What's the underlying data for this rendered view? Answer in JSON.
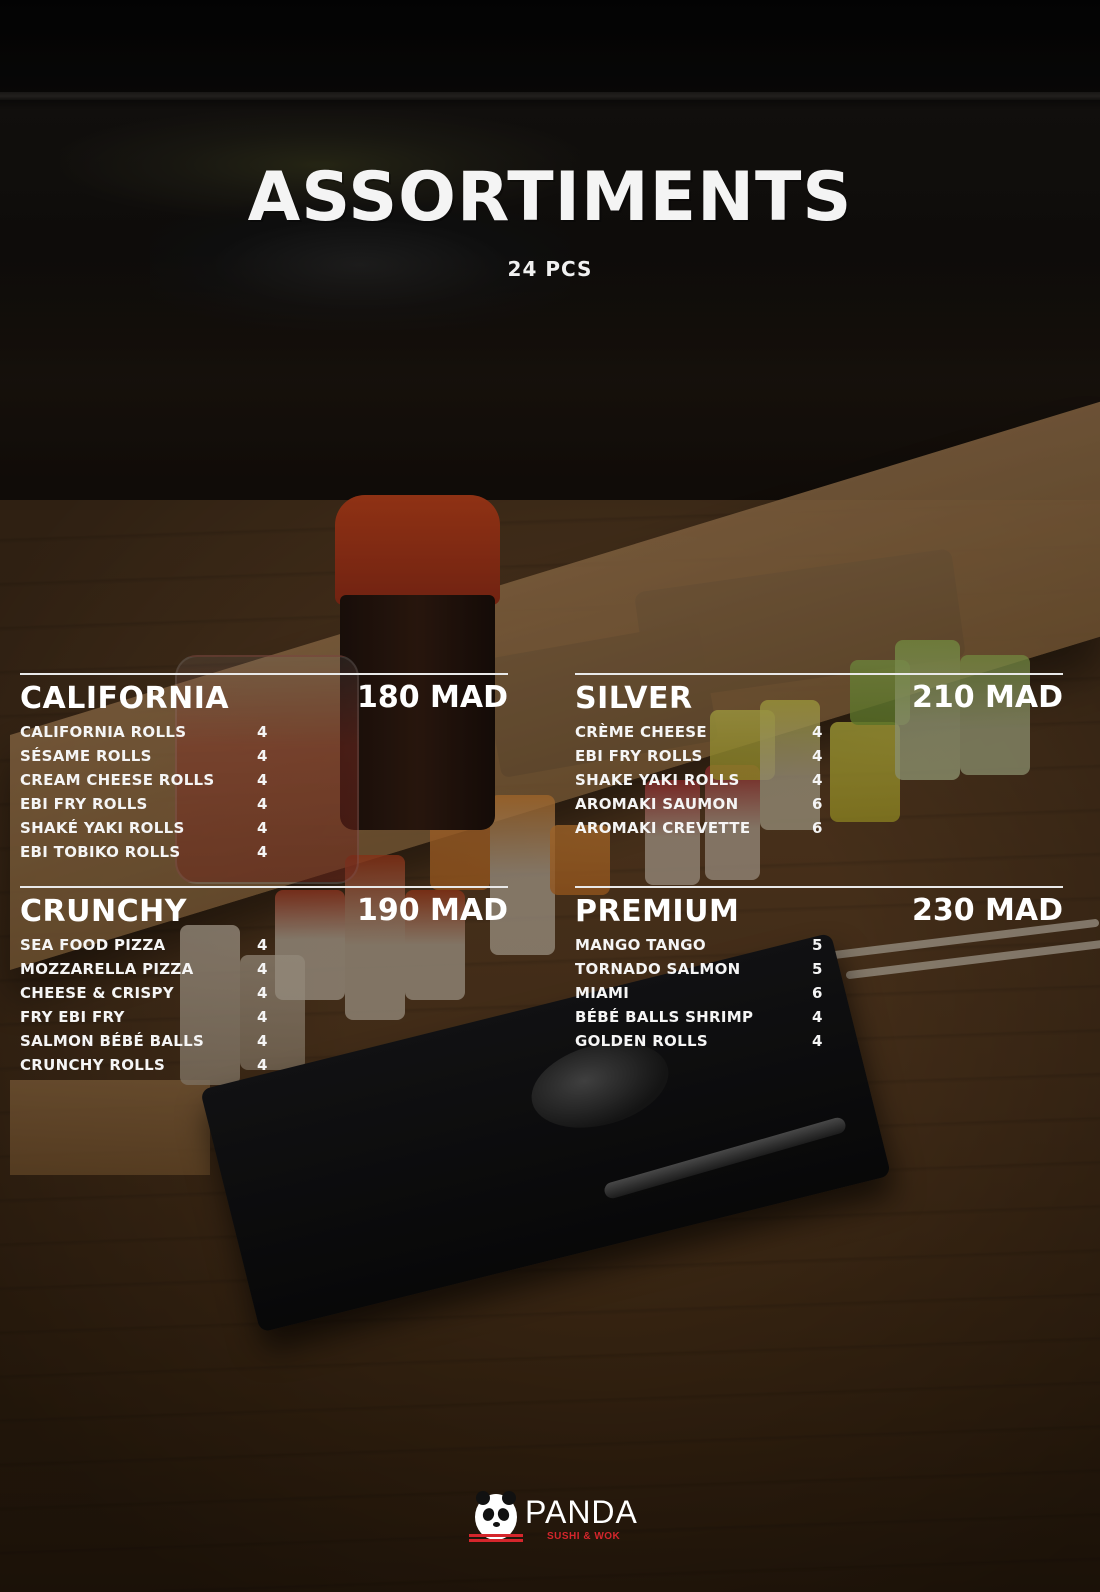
{
  "header": {
    "title": "ASSORTIMENTS",
    "subtitle": "24 PCS"
  },
  "sections": [
    {
      "name": "CALIFORNIA",
      "price": "180 MAD",
      "items": [
        {
          "label": "CALIFORNIA ROLLS",
          "qty": "4"
        },
        {
          "label": "SÉSAME ROLLS",
          "qty": "4"
        },
        {
          "label": "CREAM CHEESE ROLLS",
          "qty": "4"
        },
        {
          "label": "EBI FRY ROLLS",
          "qty": "4"
        },
        {
          "label": "SHAKÉ YAKI ROLLS",
          "qty": "4"
        },
        {
          "label": "EBI TOBIKO ROLLS",
          "qty": "4"
        }
      ]
    },
    {
      "name": "SILVER",
      "price": "210 MAD",
      "items": [
        {
          "label": "CRÈME CHEESE",
          "qty": "4"
        },
        {
          "label": "EBI FRY ROLLS",
          "qty": "4"
        },
        {
          "label": "SHAKE YAKI ROLLS",
          "qty": "4"
        },
        {
          "label": "AROMAKI SAUMON",
          "qty": "6"
        },
        {
          "label": "AROMAKI CREVETTE",
          "qty": "6"
        }
      ]
    },
    {
      "name": "CRUNCHY",
      "price": "190 MAD",
      "items": [
        {
          "label": "SEA FOOD PIZZA",
          "qty": "4"
        },
        {
          "label": "MOZZARELLA PIZZA",
          "qty": "4"
        },
        {
          "label": "CHEESE & CRISPY",
          "qty": "4"
        },
        {
          "label": "FRY EBI FRY",
          "qty": "4"
        },
        {
          "label": "SALMON BÉBÉ BALLS",
          "qty": "4"
        },
        {
          "label": "CRUNCHY ROLLS",
          "qty": "4"
        }
      ]
    },
    {
      "name": "PREMIUM",
      "price": "230 MAD",
      "items": [
        {
          "label": "MANGO TANGO",
          "qty": "5"
        },
        {
          "label": "TORNADO SALMON",
          "qty": "5"
        },
        {
          "label": "MIAMI",
          "qty": "6"
        },
        {
          "label": "BÉBÉ BALLS SHRIMP",
          "qty": "4"
        },
        {
          "label": "GOLDEN ROLLS",
          "qty": "4"
        }
      ]
    }
  ],
  "brand": {
    "name": "PANDA",
    "tagline": "SUSHI & WOK",
    "logo_icon": "panda-icon",
    "accent_color": "#d5262c"
  }
}
